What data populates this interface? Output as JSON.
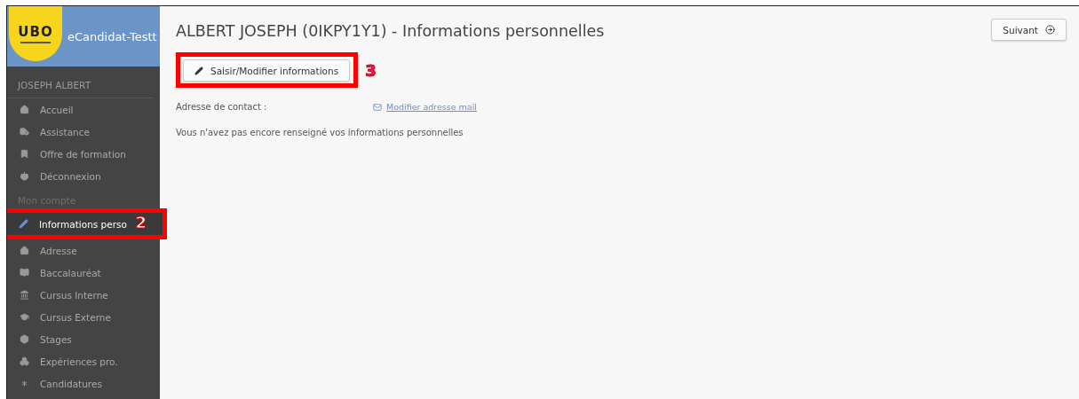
{
  "app": {
    "logo": "UBO",
    "title": "eCandidat-Testt"
  },
  "sidebar": {
    "user": "JOSEPH ALBERT",
    "groups": [
      {
        "items": [
          {
            "label": "Accueil",
            "selected": false
          },
          {
            "label": "Assistance",
            "selected": false
          },
          {
            "label": "Offre de formation",
            "selected": false
          },
          {
            "label": "Déconnexion",
            "selected": false
          }
        ]
      },
      {
        "heading": "Mon compte",
        "items": [
          {
            "label": "Informations perso",
            "selected": true,
            "callout": "2"
          },
          {
            "label": "Adresse",
            "selected": false
          },
          {
            "label": "Baccalauréat",
            "selected": false
          },
          {
            "label": "Cursus Interne",
            "selected": false
          },
          {
            "label": "Cursus Externe",
            "selected": false
          },
          {
            "label": "Stages",
            "selected": false
          },
          {
            "label": "Expériences pro.",
            "selected": false
          },
          {
            "label": "Candidatures",
            "selected": false
          }
        ]
      }
    ]
  },
  "main": {
    "title": "ALBERT JOSEPH (0IKPY1Y1) - Informations personnelles",
    "next_button": "Suivant",
    "edit_button": {
      "label": "Saisir/Modifier informations",
      "callout": "3"
    },
    "contact_label": "Adresse de contact :",
    "contact_link": "Modifier adresse mail",
    "message": "Vous n'avez pas encore renseigné vos informations personnelles"
  }
}
